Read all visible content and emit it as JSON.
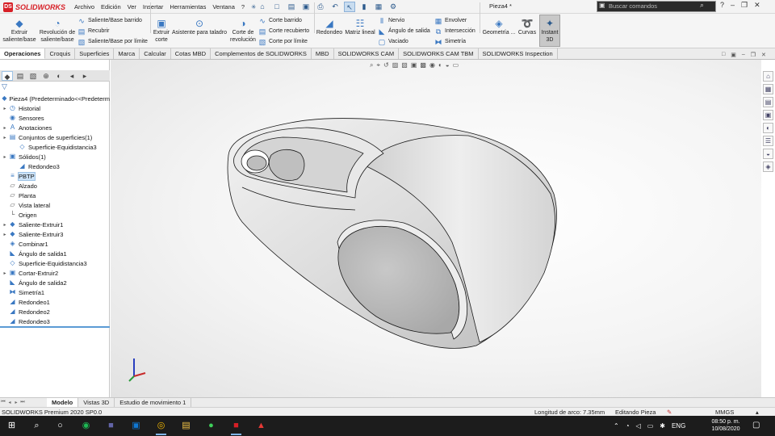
{
  "app": {
    "brand": "SOLIDWORKS",
    "doc_title": "Pieza4 *"
  },
  "menu": [
    "Archivo",
    "Edición",
    "Ver",
    "Insertar",
    "Herramientas",
    "Ventana",
    "?"
  ],
  "search": {
    "placeholder": "Buscar comandos"
  },
  "command_manager": {
    "extruir_saliente": "Extruir saliente/base",
    "revolucion_saliente": "Revolución de saliente/base",
    "saliente_barrido": "Saliente/Base barrido",
    "recubrir": "Recubrir",
    "saliente_limite": "Saliente/Base por límite",
    "extruir_corte": "Extruir corte",
    "asistente_taladro": "Asistente para taladro",
    "corte_revolucion": "Corte de revolución",
    "corte_barrido": "Corte barrido",
    "corte_recubierto": "Corte recubierto",
    "corte_limite": "Corte por límite",
    "redondeo": "Redondeo",
    "matriz_lineal": "Matriz lineal",
    "nervio": "Nervio",
    "angulo_salida": "Ángulo de salida",
    "vaciado": "Vaciado",
    "envolver": "Envolver",
    "interseccion": "Intersección",
    "simetria": "Simetría",
    "geometria": "Geometría ...",
    "curvas": "Curvas",
    "instant3d": "Instant 3D"
  },
  "tabs": [
    "Operaciones",
    "Croquis",
    "Superficies",
    "Marca",
    "Calcular",
    "Cotas MBD",
    "Complementos de SOLIDWORKS",
    "MBD",
    "SOLIDWORKS CAM",
    "SOLIDWORKS CAM TBM",
    "SOLIDWORKS Inspection"
  ],
  "tree": [
    {
      "label": "Pieza4  (Predeterminado<<Predeterm",
      "icon": "part-icon",
      "indent": 0,
      "arrow": false
    },
    {
      "label": "Historial",
      "icon": "history-icon",
      "indent": 1,
      "arrow": true
    },
    {
      "label": "Sensores",
      "icon": "sensor-icon",
      "indent": 1,
      "arrow": false
    },
    {
      "label": "Anotaciones",
      "icon": "annotation-icon",
      "indent": 1,
      "arrow": true
    },
    {
      "label": "Conjuntos de superficies(1)",
      "icon": "surface-bodies-icon",
      "indent": 1,
      "arrow": true
    },
    {
      "label": "Superficie-Equidistancia3",
      "icon": "surface-icon",
      "indent": 2,
      "arrow": false
    },
    {
      "label": "Sólidos(1)",
      "icon": "solid-bodies-icon",
      "indent": 1,
      "arrow": true
    },
    {
      "label": "Redondeo3",
      "icon": "fillet-icon",
      "indent": 2,
      "arrow": false
    },
    {
      "label": "PBTP",
      "icon": "material-icon",
      "indent": 1,
      "arrow": false,
      "selected": true
    },
    {
      "label": "Alzado",
      "icon": "plane-icon",
      "indent": 1,
      "arrow": false
    },
    {
      "label": "Planta",
      "icon": "plane-icon",
      "indent": 1,
      "arrow": false
    },
    {
      "label": "Vista lateral",
      "icon": "plane-icon",
      "indent": 1,
      "arrow": false
    },
    {
      "label": "Origen",
      "icon": "origin-icon",
      "indent": 1,
      "arrow": false
    },
    {
      "label": "Saliente-Extruir1",
      "icon": "extrude-icon",
      "indent": 1,
      "arrow": true
    },
    {
      "label": "Saliente-Extruir3",
      "icon": "extrude-icon",
      "indent": 1,
      "arrow": true
    },
    {
      "label": "Combinar1",
      "icon": "combine-icon",
      "indent": 1,
      "arrow": false
    },
    {
      "label": "Ángulo de salida1",
      "icon": "draft-icon",
      "indent": 1,
      "arrow": false
    },
    {
      "label": "Superficie-Equidistancia3",
      "icon": "surface-icon",
      "indent": 1,
      "arrow": false
    },
    {
      "label": "Cortar-Extruir2",
      "icon": "cut-extrude-icon",
      "indent": 1,
      "arrow": true
    },
    {
      "label": "Ángulo de salida2",
      "icon": "draft-icon",
      "indent": 1,
      "arrow": false
    },
    {
      "label": "Simetría1",
      "icon": "mirror-icon",
      "indent": 1,
      "arrow": false
    },
    {
      "label": "Redondeo1",
      "icon": "fillet-icon",
      "indent": 1,
      "arrow": false
    },
    {
      "label": "Redondeo2",
      "icon": "fillet-icon",
      "indent": 1,
      "arrow": false
    },
    {
      "label": "Redondeo3",
      "icon": "fillet-icon",
      "indent": 1,
      "arrow": false
    }
  ],
  "bottom_tabs": [
    "Modelo",
    "Vistas 3D",
    "Estudio de movimiento 1"
  ],
  "status": {
    "left": "SOLIDWORKS Premium 2020 SP0.0",
    "arc_length": "Longitud de arco: 7.35mm",
    "mode": "Editando Pieza",
    "units": "MMGS"
  },
  "taskbar": {
    "lang": "ENG",
    "time": "08:50 p. m.",
    "date": "10/08/2020"
  },
  "colors": {
    "accent": "#d71f26",
    "selection": "#cde3f7",
    "taskbar": "#1c1c1c"
  }
}
